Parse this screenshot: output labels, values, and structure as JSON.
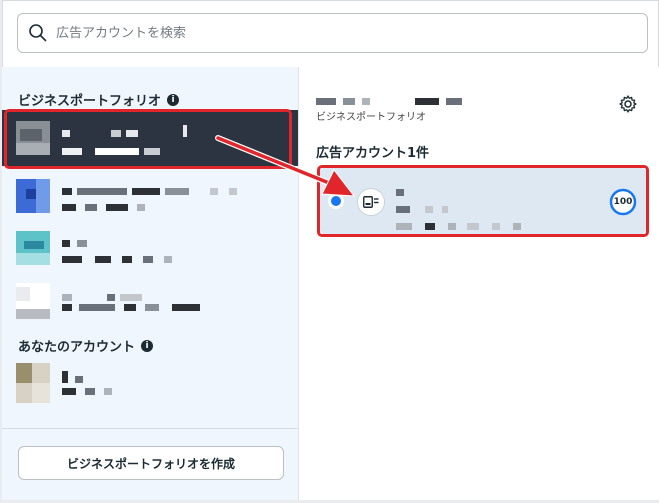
{
  "search": {
    "placeholder": "広告アカウントを検索"
  },
  "left_panel": {
    "business_portfolio_title": "ビジネスポートフォリオ",
    "your_accounts_title": "あなたのアカウント",
    "create_button_label": "ビジネスポートフォリオを作成"
  },
  "right_panel": {
    "portfolio_type_label": "ビジネスポートフォリオ",
    "ad_accounts_title": "広告アカウント1件",
    "ad_account": {
      "score": "100"
    }
  },
  "colors": {
    "highlight": "#e0262a",
    "selected_row": "#2b3440",
    "accent": "#1877f2"
  },
  "icons": [
    "search-icon",
    "info-icon",
    "gear-icon",
    "ad-account-icon",
    "status-dot-icon",
    "score-ring-icon",
    "arrow-annotation"
  ]
}
